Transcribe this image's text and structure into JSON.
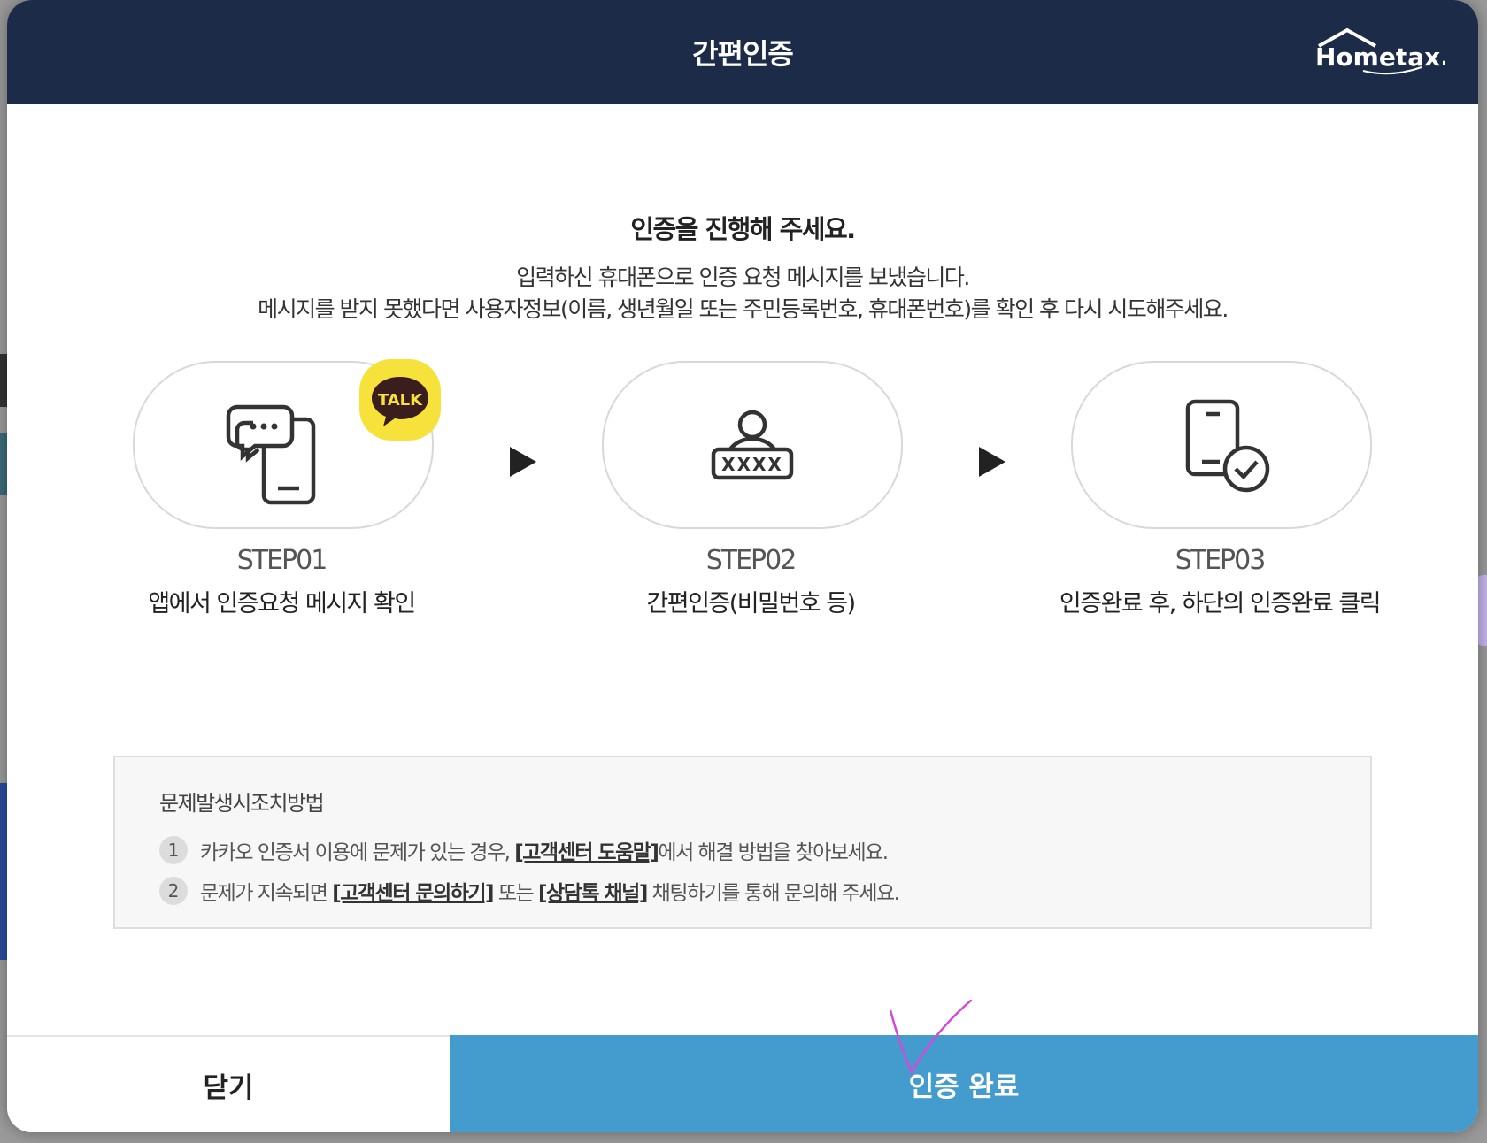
{
  "dialog": {
    "title": "간편인증",
    "logo_text": "Hometax."
  },
  "heading": "인증을 진행해 주세요.",
  "description": {
    "line1": "입력하신 휴대폰으로 인증 요청 메시지를 보냈습니다.",
    "line2": "메시지를 받지 못했다면 사용자정보(이름, 생년월일 또는 주민등록번호, 휴대폰번호)를 확인 후 다시 시도해주세요."
  },
  "steps": [
    {
      "title": "STEP01",
      "desc": "앱에서 인증요청 메시지 확인",
      "icon": "chat-phone-icon",
      "badge": "TALK"
    },
    {
      "title": "STEP02",
      "desc": "간편인증(비밀번호 등)",
      "icon": "user-password-icon",
      "password_mask": "XXXX"
    },
    {
      "title": "STEP03",
      "desc": "인증완료 후, 하단의 인증완료 클릭",
      "icon": "phone-check-icon"
    }
  ],
  "help": {
    "title": "문제발생시조치방법",
    "items": [
      {
        "num": "1",
        "pre": "카카오 인증서 이용에 문제가 있는 경우,",
        "link1": "[고객센터 도움말]",
        "post": "에서 해결 방법을 찾아보세요."
      },
      {
        "num": "2",
        "pre": "문제가 지속되면",
        "link1": "[고객센터 문의하기]",
        "mid": "또는",
        "link2": "[상담톡 채널]",
        "post": "채팅하기를 통해 문의해 주세요."
      }
    ]
  },
  "buttons": {
    "close": "닫기",
    "done": "인증 완료"
  },
  "colors": {
    "header": "#1c2b48",
    "primary": "#439ccd",
    "talk_yellow": "#f7e23b"
  }
}
